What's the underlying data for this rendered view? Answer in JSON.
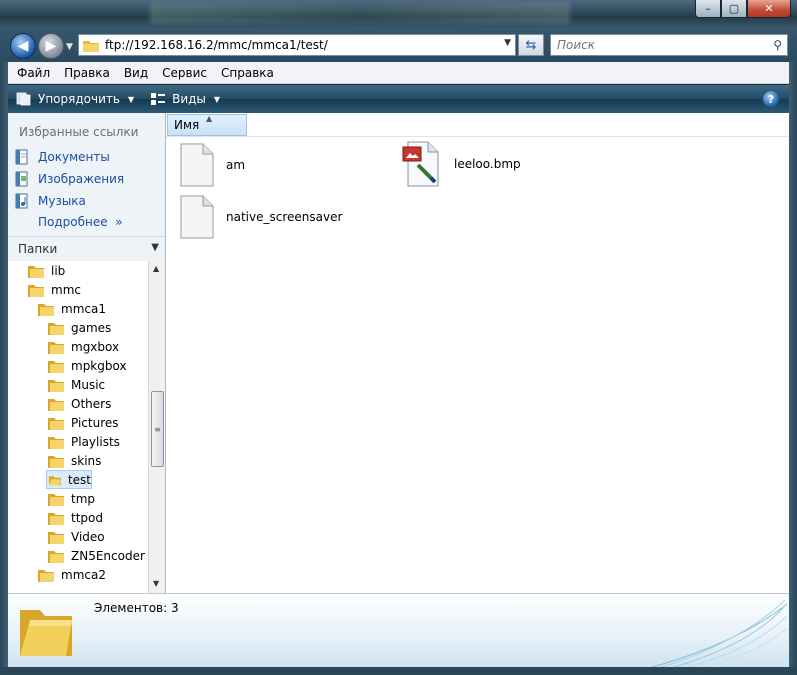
{
  "window": {
    "buttons": [
      "–",
      "▢",
      "✕"
    ]
  },
  "address": {
    "path": "ftp://192.168.16.2/mmc/mmca1/test/",
    "search_placeholder": "Поиск"
  },
  "menu": [
    "Файл",
    "Правка",
    "Вид",
    "Сервис",
    "Справка"
  ],
  "toolbar": {
    "organize": "Упорядочить",
    "views": "Виды",
    "help": "?"
  },
  "favorites": {
    "title": "Избранные ссылки",
    "items": [
      {
        "label": "Документы",
        "icon": "documents-icon"
      },
      {
        "label": "Изображения",
        "icon": "pictures-icon"
      },
      {
        "label": "Музыка",
        "icon": "music-icon"
      }
    ],
    "more": "Подробнее"
  },
  "folders": {
    "title": "Папки",
    "items": [
      {
        "label": "lib",
        "level": 1
      },
      {
        "label": "mmc",
        "level": 1
      },
      {
        "label": "mmca1",
        "level": 2
      },
      {
        "label": "games",
        "level": 3
      },
      {
        "label": "mgxbox",
        "level": 3
      },
      {
        "label": "mpkgbox",
        "level": 3
      },
      {
        "label": "Music",
        "level": 3
      },
      {
        "label": "Others",
        "level": 3
      },
      {
        "label": "Pictures",
        "level": 3
      },
      {
        "label": "Playlists",
        "level": 3
      },
      {
        "label": "skins",
        "level": 3
      },
      {
        "label": "test",
        "level": 3,
        "selected": true
      },
      {
        "label": "tmp",
        "level": 3
      },
      {
        "label": "ttpod",
        "level": 3
      },
      {
        "label": "Video",
        "level": 3
      },
      {
        "label": "ZN5Encoder",
        "level": 3
      },
      {
        "label": "mmca2",
        "level": 2
      }
    ]
  },
  "columns": {
    "name": "Имя"
  },
  "files": [
    {
      "name": "am",
      "type": "blank"
    },
    {
      "name": "leeloo.bmp",
      "type": "bitmap"
    },
    {
      "name": "native_screensaver",
      "type": "blank"
    }
  ],
  "details": {
    "count": "Элементов: 3"
  }
}
